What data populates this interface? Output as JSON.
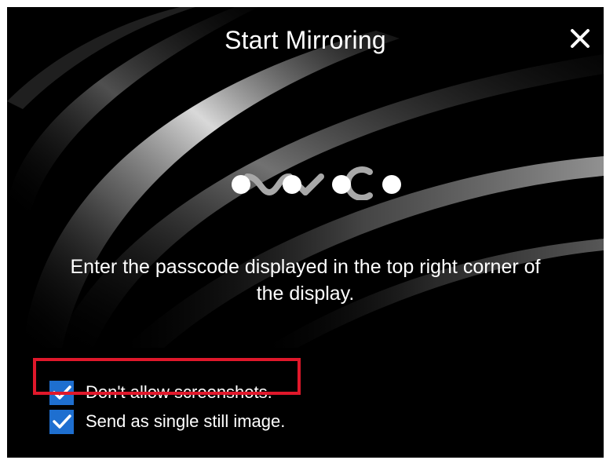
{
  "dialog": {
    "title": "Start Mirroring",
    "close_icon": "close-icon",
    "logo": "vaio-logo",
    "instructions": "Enter the passcode displayed in the top right corner of the display."
  },
  "options": [
    {
      "label": "Don't allow screenshots.",
      "checked": true
    },
    {
      "label": "Send as single still image.",
      "checked": true
    }
  ],
  "colors": {
    "background": "#000000",
    "text": "#ffffff",
    "checkbox": "#1e6fd0",
    "highlight": "#e0182b"
  }
}
